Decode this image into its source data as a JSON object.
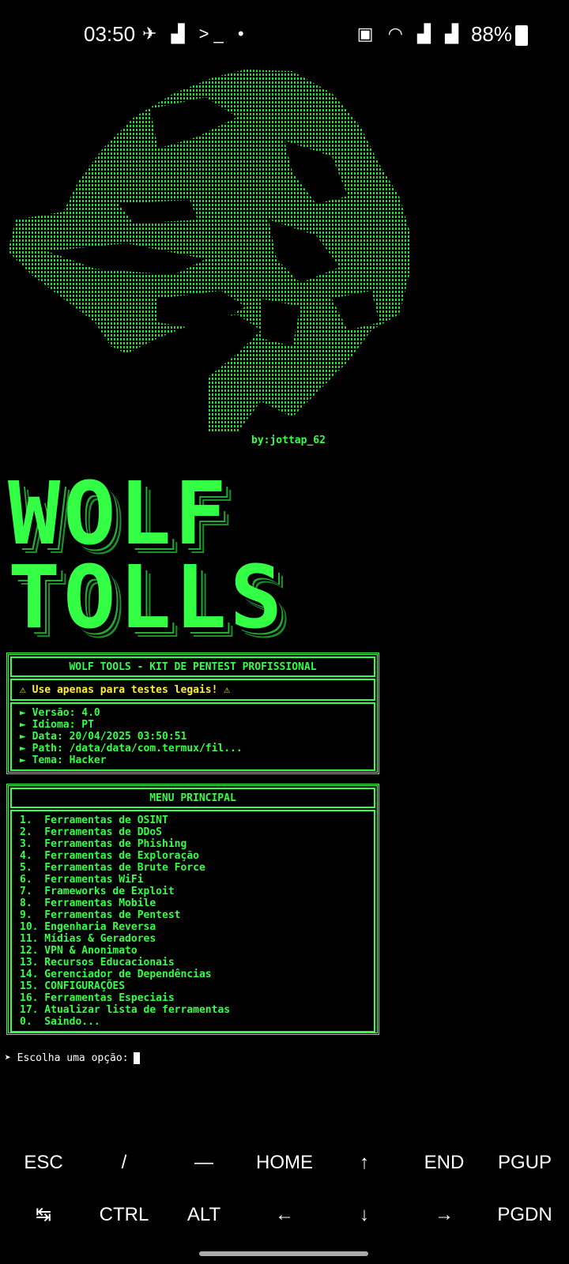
{
  "status_bar": {
    "time": "03:50",
    "battery": "88%"
  },
  "credit": "by:jottap_62",
  "banner": {
    "line1": "WOLF",
    "line2": "TOLLS"
  },
  "info_box": {
    "title": "WOLF TOOLS - KIT DE PENTEST PROFISSIONAL",
    "warning": "⚠ Use apenas para testes legais! ⚠",
    "lines": [
      "► Versão: 4.0",
      "► Idioma: PT",
      "► Data: 20/04/2025 03:50:51",
      "► Path: /data/data/com.termux/fil...",
      "► Tema: Hacker"
    ]
  },
  "menu": {
    "title": "MENU PRINCIPAL",
    "items": [
      "1.  Ferramentas de OSINT",
      "2.  Ferramentas de DDoS",
      "3.  Ferramentas de Phishing",
      "4.  Ferramentas de Exploração",
      "5.  Ferramentas de Brute Force",
      "6.  Ferramentas WiFi",
      "7.  Frameworks de Exploit",
      "8.  Ferramentas Mobile",
      "9.  Ferramentas de Pentest",
      "10. Engenharia Reversa",
      "11. Mídias & Geradores",
      "12. VPN & Anonimato",
      "13. Recursos Educacionais",
      "14. Gerenciador de Dependências",
      "15. CONFIGURAÇÕES",
      "16. Ferramentas Especiais",
      "17. Atualizar lista de ferramentas",
      "0.  Saindo..."
    ]
  },
  "prompt": "➤ Escolha uma opção:",
  "extra_keys": {
    "row1": [
      "ESC",
      "/",
      "—",
      "HOME",
      "↑",
      "END",
      "PGUP"
    ],
    "row2": [
      "↹",
      "CTRL",
      "ALT",
      "←",
      "↓",
      "→",
      "PGDN"
    ]
  },
  "colors": {
    "terminal_green": "#33ff44",
    "warning_yellow": "#ffee33",
    "background": "#000000"
  }
}
